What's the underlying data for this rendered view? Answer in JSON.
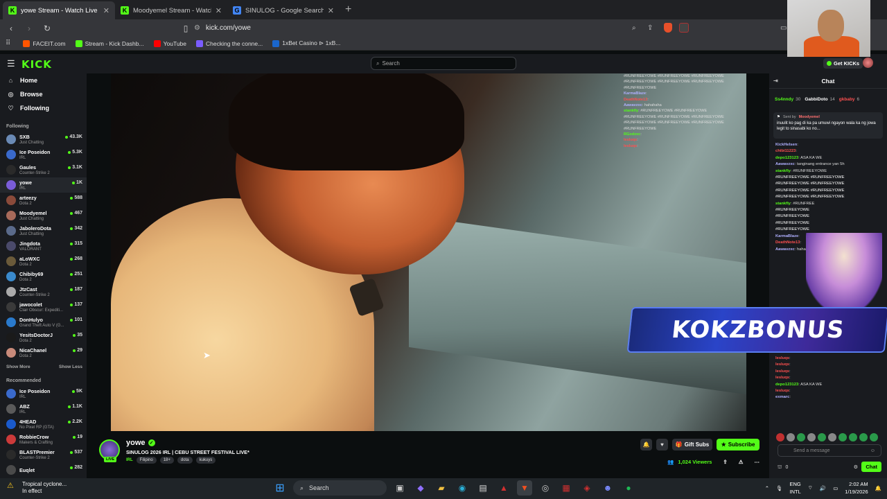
{
  "browser": {
    "tabs": [
      {
        "title": "yowe Stream - Watch Live on",
        "active": true,
        "favicon": "kick-icon",
        "color": "#53fc18"
      },
      {
        "title": "Moodyemel Stream - Watch Live on",
        "active": false,
        "favicon": "kick-icon",
        "color": "#53fc18"
      },
      {
        "title": "SINULOG - Google Search",
        "active": false,
        "favicon": "google-icon",
        "color": "#4285f4"
      }
    ],
    "url": "kick.com/yowe",
    "bookmarks": [
      {
        "label": "FACEIT.com",
        "color": "#ff5500"
      },
      {
        "label": "Stream - Kick Dashb...",
        "color": "#53fc18"
      },
      {
        "label": "YouTube",
        "color": "#ff0000"
      },
      {
        "label": "Checking the conne...",
        "color": "#7a5cff"
      },
      {
        "label": "1xBet Casino ⊳ 1xB...",
        "color": "#1a66cc"
      }
    ]
  },
  "kick": {
    "logo": "KICK",
    "search_placeholder": "Search",
    "get_kicks": "Get KICKs",
    "nav": [
      {
        "label": "Home",
        "icon": "home-icon"
      },
      {
        "label": "Browse",
        "icon": "compass-icon"
      },
      {
        "label": "Following",
        "icon": "heart-icon"
      }
    ],
    "following_header": "Following",
    "following": [
      {
        "name": "SXB",
        "game": "Just Chatting",
        "viewers": "43.3K",
        "color": "#6a8ab5"
      },
      {
        "name": "Ice Poseidon",
        "game": "IRL",
        "viewers": "5.3K",
        "color": "#3a6acc"
      },
      {
        "name": "Gaules",
        "game": "Counter-Strike 2",
        "viewers": "3.1K",
        "color": "#2a2a2a"
      },
      {
        "name": "yowe",
        "game": "IRL",
        "viewers": "1K",
        "color": "#7a5cd8"
      },
      {
        "name": "arteezy",
        "game": "Dota 2",
        "viewers": "588",
        "color": "#8a4a3a"
      },
      {
        "name": "Moodyemel",
        "game": "Just Chatting",
        "viewers": "467",
        "color": "#a86a5a"
      },
      {
        "name": "JaboleroDota",
        "game": "Just Chatting",
        "viewers": "342",
        "color": "#5a6a8a"
      },
      {
        "name": "Jingdota",
        "game": "VALORANT",
        "viewers": "315",
        "color": "#4a4a6a"
      },
      {
        "name": "aLoWXC",
        "game": "Dota 2",
        "viewers": "268",
        "color": "#6a5a3a"
      },
      {
        "name": "Chibiby69",
        "game": "Dota 2",
        "viewers": "251",
        "color": "#3a8acc"
      },
      {
        "name": "JtzCast",
        "game": "Counter-Strike 2",
        "viewers": "187",
        "color": "#aaaaaa"
      },
      {
        "name": "jawocolet",
        "game": "Clair Obscur: Expediti...",
        "viewers": "137",
        "color": "#3a3a3a"
      },
      {
        "name": "DonHulyo",
        "game": "Grand Theft Auto V (G...",
        "viewers": "101",
        "color": "#2a7acc"
      },
      {
        "name": "YesitsDoctorJ",
        "game": "Dota 2",
        "viewers": "35",
        "color": "#1a1a1a"
      },
      {
        "name": "NicaChanel",
        "game": "Dota 2",
        "viewers": "29",
        "color": "#c88a7a"
      }
    ],
    "show_more": "Show More",
    "show_less": "Show Less",
    "recommended_header": "Recommended",
    "recommended": [
      {
        "name": "Ice Poseidon",
        "game": "IRL",
        "viewers": "5K",
        "color": "#3a6acc"
      },
      {
        "name": "ABZ",
        "game": "IRL",
        "viewers": "1.1K",
        "color": "#5a5a5a"
      },
      {
        "name": "4HEAD",
        "game": "No Pixel RP (GTA)",
        "viewers": "2.2K",
        "color": "#1a5acc"
      },
      {
        "name": "RobbieCrow",
        "game": "Makers & Crafting",
        "viewers": "19",
        "color": "#cc3a3a"
      },
      {
        "name": "BLASTPremier",
        "game": "Counter-Strike 2",
        "viewers": "537",
        "color": "#2a2a2a"
      },
      {
        "name": "Euqlet",
        "game": "",
        "viewers": "282",
        "color": "#4a4a4a"
      }
    ]
  },
  "overlay_chat": [
    {
      "user": "",
      "text": "#RUNFREEYOWE #RUNFREEYOWE #RUNFREEYOWE",
      "color": "#ffffff"
    },
    {
      "user": "",
      "text": "#RUNFREEYOWE #RUNFREEYOWE #RUNFREEYOWE",
      "color": "#ffffff"
    },
    {
      "user": "",
      "text": "#RUNFREEYOWE",
      "color": "#ffffff"
    },
    {
      "user": "KarmaBlaze",
      "text": ":",
      "color": "#b0b0ff"
    },
    {
      "user": "DeathNote13",
      "text": ":",
      "color": "#ff5050"
    },
    {
      "user": "Aawavzxc",
      "text": ": hahahaha",
      "color": "#b0b0ff"
    },
    {
      "user": "stankfly",
      "text": ": #RUNFREEYOWE #RUNFREEYOWE",
      "color": "#53fc18"
    },
    {
      "user": "",
      "text": "#RUNFREEYOWE #RUNFREEYOWE #RUNFREEYOWE",
      "color": "#ffffff"
    },
    {
      "user": "",
      "text": "#RUNFREEYOWE #RUNFREEYOWE #RUNFREEYOWE",
      "color": "#ffffff"
    },
    {
      "user": "",
      "text": "#RUNFREEYOWE",
      "color": "#ffffff"
    },
    {
      "user": "RGodzxc",
      "text": ":",
      "color": "#53fc18"
    },
    {
      "user": "lesluqs",
      "text": ":",
      "color": "#ff5050"
    },
    {
      "user": "lesluqs",
      "text": ":",
      "color": "#ff5050"
    }
  ],
  "stream": {
    "channel": "yowe",
    "live_badge": "LIVE",
    "title": "SINULOG 2026 IRL | CEBU STREET FESTIVAL LIVE*",
    "category": "IRL",
    "tags": [
      "Filipino",
      "18+",
      "dota",
      "kukuys"
    ],
    "gift_subs": "Gift Subs",
    "subscribe": "Subscribe",
    "viewers": "1,024 Viewers"
  },
  "chat": {
    "header": "Chat",
    "gifters": [
      {
        "name": "Ss4nndy",
        "count": "30",
        "color": "#53fc18"
      },
      {
        "name": "GabbiDoto",
        "count": "14",
        "color": "#ffffff"
      },
      {
        "name": "gkbaby",
        "count": "6",
        "color": "#ff5050"
      }
    ],
    "pinned_by": "Sent by",
    "pinned_user": "Moodyemel",
    "pinned_text": "inuulit ko pag di ka pa umuwi ngayon wala ka ng jowa legit to sinasabi ko no...",
    "messages": [
      {
        "user": "KickHelsen",
        "text": ":",
        "color": "#b0b0ff"
      },
      {
        "user": "chibi11223",
        "text": ":",
        "color": "#ff5050"
      },
      {
        "user": "depo123123",
        "text": ": ASA KA WE",
        "color": "#53fc18"
      },
      {
        "user": "Aawavzxc",
        "text": ": tanginang entrance yan 5h",
        "color": "#b0b0ff"
      },
      {
        "user": "stankfly",
        "text": ": #RUNFREEYOWE",
        "color": "#53fc18"
      },
      {
        "user": "",
        "text": "#RUNFREEYOWE #RUNFREEYOWE",
        "color": "#ffffff"
      },
      {
        "user": "",
        "text": "#RUNFREEYOWE #RUNFREEYOWE",
        "color": "#ffffff"
      },
      {
        "user": "",
        "text": "#RUNFREEYOWE #RUNFREEYOWE",
        "color": "#ffffff"
      },
      {
        "user": "",
        "text": "#RUNFREEYOWE #RUNFREEYOWE",
        "color": "#ffffff"
      },
      {
        "user": "stankfly",
        "text": ": #RUNFREE",
        "color": "#53fc18"
      },
      {
        "user": "",
        "text": "#RUNFREEYOWE",
        "color": "#ffffff"
      },
      {
        "user": "",
        "text": "#RUNFREEYOWE",
        "color": "#ffffff"
      },
      {
        "user": "",
        "text": "#RUNFREEYOWE",
        "color": "#ffffff"
      },
      {
        "user": "",
        "text": "#RUNFREEYOWE",
        "color": "#ffffff"
      },
      {
        "user": "KarmaBlaze",
        "text": ":",
        "color": "#b0b0ff"
      },
      {
        "user": "DeathNote13",
        "text": ":",
        "color": "#ff5050"
      },
      {
        "user": "Aawavzxc",
        "text": ": hahahaha",
        "color": "#b0b0ff"
      }
    ],
    "messages_lower": [
      {
        "user": "lesluqs",
        "text": ":",
        "color": "#ff5050"
      },
      {
        "user": "lesluqs",
        "text": ":",
        "color": "#ff5050"
      },
      {
        "user": "lesluqs",
        "text": ":",
        "color": "#ff5050"
      },
      {
        "user": "lesluqs",
        "text": ":",
        "color": "#ff5050"
      },
      {
        "user": "depo123123",
        "text": ": ASA KA WE",
        "color": "#53fc18"
      },
      {
        "user": "lesluqs",
        "text": ":",
        "color": "#ff5050"
      },
      {
        "user": "exmarc",
        "text": ":",
        "color": "#b0b0ff"
      }
    ],
    "send_placeholder": "Send a message",
    "points": "0",
    "chat_button": "Chat"
  },
  "overlay_banner": "KOKZBONUS",
  "taskbar": {
    "weather_title": "Tropical cyclone...",
    "weather_sub": "In effect",
    "search": "Search",
    "lang": "ENG",
    "layout": "INTL",
    "time": "2:02 AM",
    "date": "1/19/2026"
  }
}
